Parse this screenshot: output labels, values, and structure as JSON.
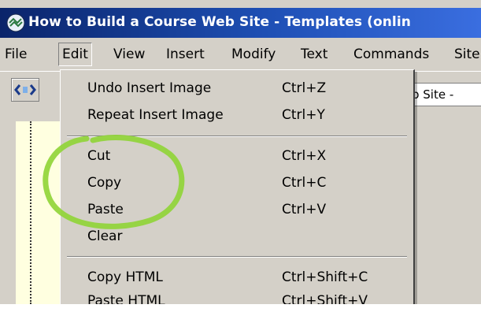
{
  "window": {
    "title": "How to Build a Course Web Site - Templates (onlin"
  },
  "menubar": {
    "items": [
      "File",
      "Edit",
      "View",
      "Insert",
      "Modify",
      "Text",
      "Commands",
      "Site"
    ]
  },
  "toolbar": {
    "field_value": "b Site -"
  },
  "edit_menu": {
    "items": [
      {
        "label": "Undo Insert Image",
        "shortcut": "Ctrl+Z"
      },
      {
        "label": "Repeat Insert Image",
        "shortcut": "Ctrl+Y"
      },
      {
        "label": "Cut",
        "shortcut": "Ctrl+X"
      },
      {
        "label": "Copy",
        "shortcut": "Ctrl+C"
      },
      {
        "label": "Paste",
        "shortcut": "Ctrl+V"
      },
      {
        "label": "Clear",
        "shortcut": ""
      },
      {
        "label": "Copy HTML",
        "shortcut": "Ctrl+Shift+C"
      },
      {
        "label": "Paste HTML",
        "shortcut": "Ctrl+Shift+V"
      }
    ]
  },
  "colors": {
    "titlebar": "#0a246a",
    "menu_bg": "#d4d0c8",
    "highlight_ring": "#8fd435"
  },
  "icons": {
    "app": "dreamweaver-app-icon",
    "code_view": "code-view-icon"
  }
}
